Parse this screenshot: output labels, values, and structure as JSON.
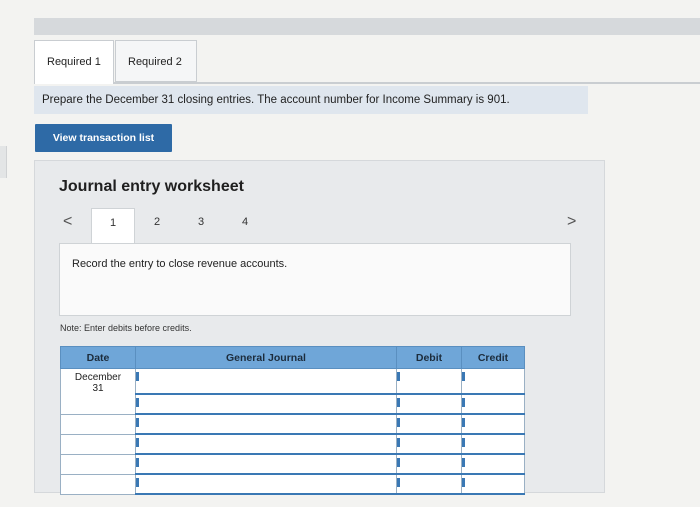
{
  "tabs": [
    {
      "label": "Required 1",
      "active": true
    },
    {
      "label": "Required 2",
      "active": false
    }
  ],
  "instruction": "Prepare the December 31 closing entries. The account number for Income Summary is 901.",
  "view_button": "View transaction list",
  "worksheet": {
    "title": "Journal entry worksheet",
    "prev_glyph": "<",
    "next_glyph": ">",
    "steps": [
      "1",
      "2",
      "3",
      "4"
    ],
    "active_step": 1,
    "record_text": "Record the entry to close revenue accounts.",
    "note": "Note: Enter debits before credits."
  },
  "journal": {
    "headers": {
      "date": "Date",
      "general_journal": "General Journal",
      "debit": "Debit",
      "credit": "Credit"
    },
    "date_month": "December",
    "date_day": "31"
  },
  "colors": {
    "accent": "#2e6aa6",
    "header": "#6fa6d8",
    "instruction_bar": "#dfe6ee"
  }
}
